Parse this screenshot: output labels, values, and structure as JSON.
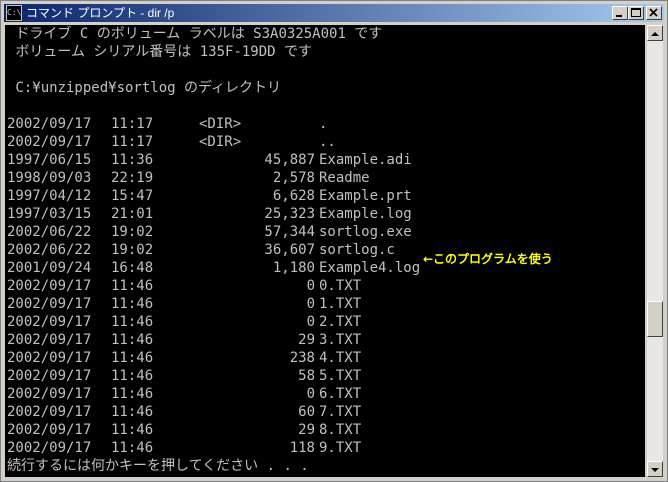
{
  "window": {
    "title": "コマンド プロンプト - dir /p",
    "icon_label": "C:\\"
  },
  "console": {
    "header": [
      " ドライブ C のボリューム ラベルは S3A0325A001 です",
      " ボリューム シリアル番号は 135F-19DD です",
      "",
      " C:¥unzipped¥sortlog のディレクトリ",
      ""
    ],
    "entries": [
      {
        "date": "2002/09/17",
        "time": "11:17",
        "dir": "<DIR>",
        "size": "",
        "name": "."
      },
      {
        "date": "2002/09/17",
        "time": "11:17",
        "dir": "<DIR>",
        "size": "",
        "name": ".."
      },
      {
        "date": "1997/06/15",
        "time": "11:36",
        "dir": "",
        "size": "45,887",
        "name": "Example.adi"
      },
      {
        "date": "1998/09/03",
        "time": "22:19",
        "dir": "",
        "size": "2,578",
        "name": "Readme"
      },
      {
        "date": "1997/04/12",
        "time": "15:47",
        "dir": "",
        "size": "6,628",
        "name": "Example.prt"
      },
      {
        "date": "1997/03/15",
        "time": "21:01",
        "dir": "",
        "size": "25,323",
        "name": "Example.log"
      },
      {
        "date": "2002/06/22",
        "time": "19:02",
        "dir": "",
        "size": "57,344",
        "name": "sortlog.exe"
      },
      {
        "date": "2002/06/22",
        "time": "19:02",
        "dir": "",
        "size": "36,607",
        "name": "sortlog.c"
      },
      {
        "date": "2001/09/24",
        "time": "16:48",
        "dir": "",
        "size": "1,180",
        "name": "Example4.log"
      },
      {
        "date": "2002/09/17",
        "time": "11:46",
        "dir": "",
        "size": "0",
        "name": "0.TXT"
      },
      {
        "date": "2002/09/17",
        "time": "11:46",
        "dir": "",
        "size": "0",
        "name": "1.TXT"
      },
      {
        "date": "2002/09/17",
        "time": "11:46",
        "dir": "",
        "size": "0",
        "name": "2.TXT"
      },
      {
        "date": "2002/09/17",
        "time": "11:46",
        "dir": "",
        "size": "29",
        "name": "3.TXT"
      },
      {
        "date": "2002/09/17",
        "time": "11:46",
        "dir": "",
        "size": "238",
        "name": "4.TXT"
      },
      {
        "date": "2002/09/17",
        "time": "11:46",
        "dir": "",
        "size": "58",
        "name": "5.TXT"
      },
      {
        "date": "2002/09/17",
        "time": "11:46",
        "dir": "",
        "size": "0",
        "name": "6.TXT"
      },
      {
        "date": "2002/09/17",
        "time": "11:46",
        "dir": "",
        "size": "60",
        "name": "7.TXT"
      },
      {
        "date": "2002/09/17",
        "time": "11:46",
        "dir": "",
        "size": "29",
        "name": "8.TXT"
      },
      {
        "date": "2002/09/17",
        "time": "11:46",
        "dir": "",
        "size": "118",
        "name": "9.TXT"
      }
    ],
    "prompt": "続行するには何かキーを押してください . . ."
  },
  "annotation": {
    "text": "←このプログラムを使う",
    "color": "#ffff00"
  },
  "colors": {
    "console_bg": "#000000",
    "console_text": "#c0c0c0",
    "titlebar_start": "#0a246a",
    "titlebar_end": "#a6caf0"
  }
}
